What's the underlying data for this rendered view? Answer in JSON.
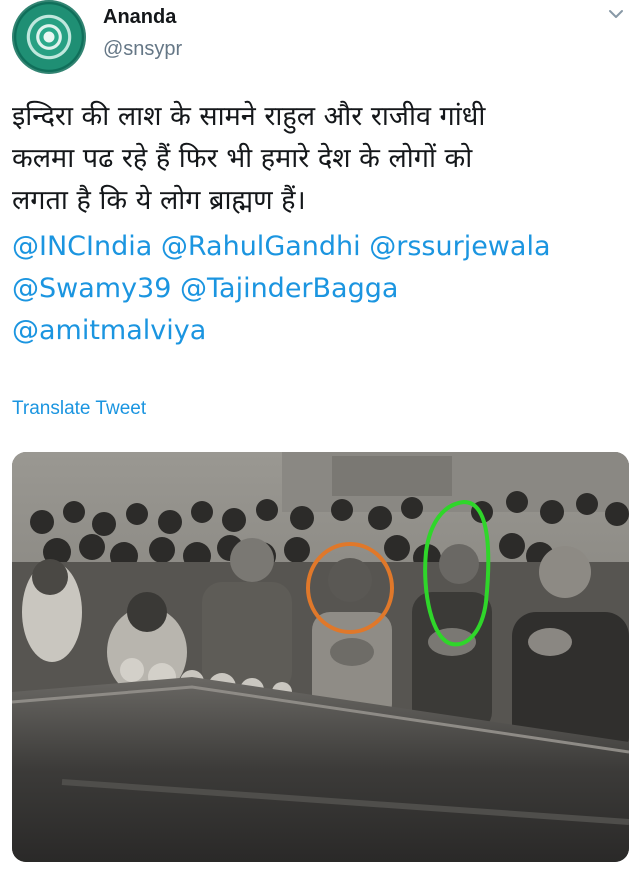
{
  "user": {
    "display_name": "Ananda",
    "handle": "@snsypr",
    "avatar_icon": "mandala-avatar-icon"
  },
  "menu": {
    "icon": "chevron-down-icon"
  },
  "tweet": {
    "lines": [
      "इन्दिरा की लाश के सामने राहुल और राजीव गांधी",
      "कलमा पढ रहे हैं फिर भी हमारे देश के लोगों को",
      "लगता है कि ये लोग ब्राह्मण हैं।"
    ],
    "mentions": [
      [
        "@INCIndia",
        "@RahulGandhi",
        "@rssurjewala"
      ],
      [
        "@Swamy39",
        "@TajinderBagga"
      ],
      [
        "@amitmalviya"
      ]
    ]
  },
  "translate_label": "Translate Tweet",
  "colors": {
    "text": "#14171a",
    "secondary": "#657786",
    "link": "#1b95e0",
    "circle_orange": "#e0782a",
    "circle_green": "#2fd62a"
  }
}
